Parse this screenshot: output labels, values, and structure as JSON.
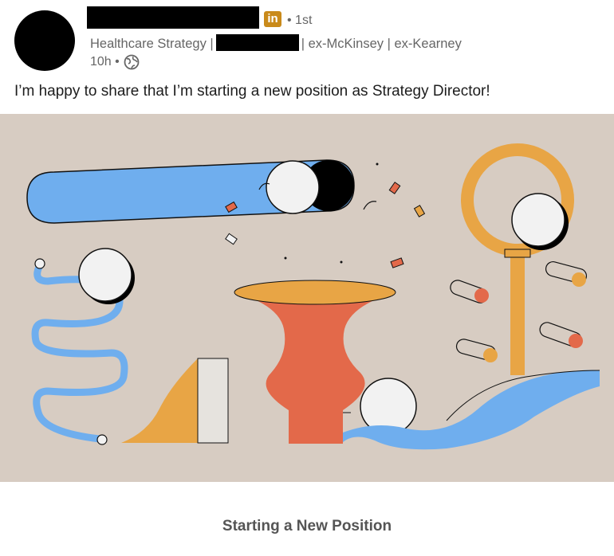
{
  "post": {
    "author": {
      "network_badge": "in",
      "connection_degree": "• 1st",
      "headline_prefix": "Healthcare Strategy |",
      "headline_suffix": "| ex-McKinsey | ex-Kearney",
      "time_ago": "10h •",
      "visibility_icon": "globe-icon"
    },
    "text": "I’m happy to share that I’m starting a new position as Strategy Director!",
    "illustration_icon": "new-position-illustration",
    "caption": "Starting a New Position"
  },
  "colors": {
    "illustration_bg": "#d7ccc2",
    "blue": "#6faeee",
    "orange": "#e3694a",
    "gold": "#e8a545",
    "white_ball": "#f2f2f2"
  }
}
